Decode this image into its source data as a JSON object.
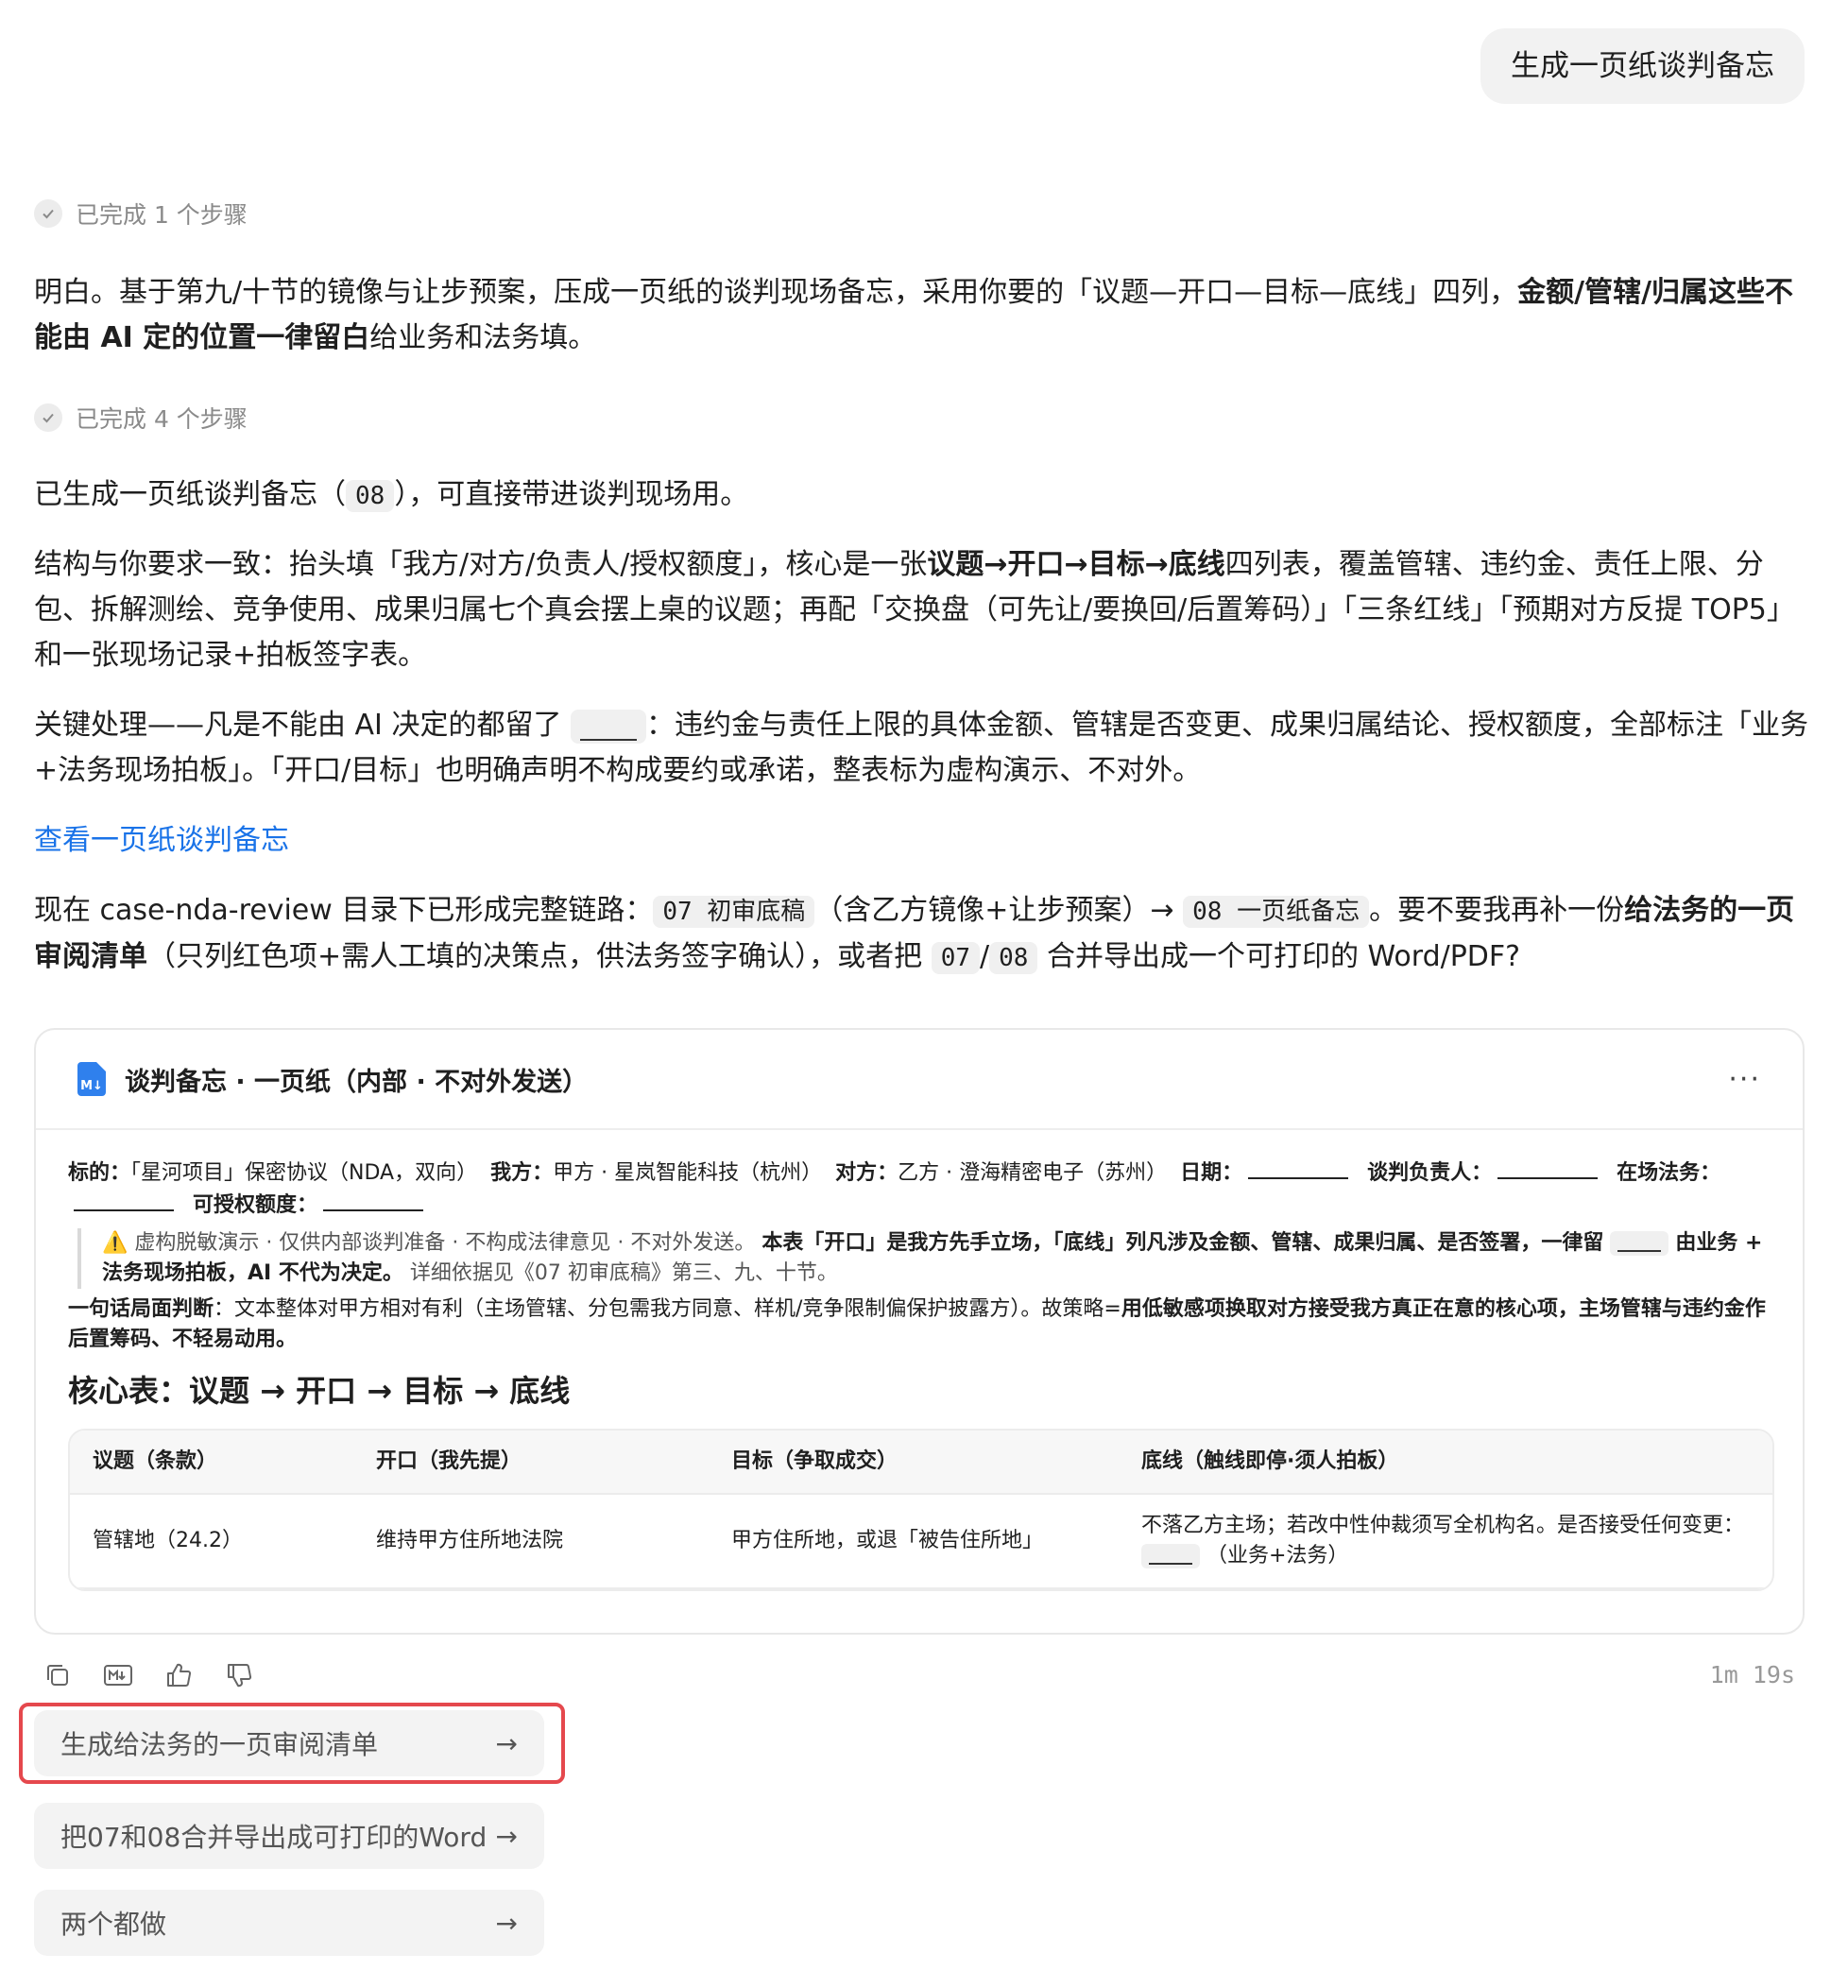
{
  "user_message": "生成一页纸谈判备忘",
  "steps1": "已完成 1 个步骤",
  "steps2": "已完成 4 个步骤",
  "para1": {
    "a": "明白。基于第九/十节的镜像与让步预案，压成一页纸的谈判现场备忘，采用你要的「议题—开口—目标—底线」四列，",
    "b": "金额/管辖/归属这些不能由 AI 定的位置一律留白",
    "c": "给业务和法务填。"
  },
  "para2": {
    "a": "已生成一页纸谈判备忘（",
    "code": "08",
    "b": "），可直接带进谈判现场用。"
  },
  "para3": {
    "a": "结构与你要求一致：抬头填「我方/对方/负责人/授权额度」，核心是一张",
    "b": "议题→开口→目标→底线",
    "c": "四列表，覆盖管辖、违约金、责任上限、分包、拆解测绘、竞争使用、成果归属七个真会摆上桌的议题；再配「交换盘（可先让/要换回/后置筹码）」「三条红线」「预期对方反提 TOP5」和一张现场记录+拍板签字表。"
  },
  "para4": {
    "a": "关键处理——凡是不能由 AI 决定的都留了",
    "b": "：违约金与责任上限的具体金额、管辖是否变更、成果归属结论、授权额度，全部标注「业务+法务现场拍板」。「开口/目标」也明确声明不构成要约或承诺，整表标为虚构演示、不对外。"
  },
  "link": "查看一页纸谈判备忘",
  "para5": {
    "a": "现在 case-nda-review 目录下已形成完整链路：",
    "code1": "07 初审底稿",
    "b": "（含乙方镜像+让步预案）→",
    "code2": "08 一页纸备忘",
    "c": "。要不要我再补一份",
    "d": "给法务的一页审阅清单",
    "e": "（只列红色项+需人工填的决策点，供法务签字确认），或者把",
    "code3": "07",
    "slash": "/",
    "code4": "08",
    "f": "合并导出成一个可打印的 Word/PDF?"
  },
  "card": {
    "title": "谈判备忘 · 一页纸（内部 · 不对外发送）",
    "more": "···",
    "md_badge": "M↓",
    "header_line": {
      "k1": "标的：",
      "v1": "「星河项目」保密协议（NDA，双向）",
      "k2": "我方：",
      "v2": "甲方 · 星岚智能科技（杭州）",
      "k3": "对方：",
      "v3": "乙方 · 澄海精密电子（苏州）",
      "k4": "日期：",
      "k5": "谈判负责人：",
      "k6": "在场法务：",
      "k7": "可授权额度："
    },
    "warning": {
      "icon": "⚠️",
      "a": "虚构脱敏演示 · 仅供内部谈判准备 · 不构成法律意见 · 不对外发送。",
      "b": "本表「开口」是我方先手立场，「底线」列凡涉及金额、管辖、成果归属、是否签署，一律留",
      "c": "由业务 + 法务现场拍板，AI 不代为决定。",
      "d": "详细依据见《07 初审底稿》第三、九、十节。"
    },
    "summary": {
      "k": "一句话局面判断",
      "a": "：文本整体对甲方相对有利（主场管辖、分包需我方同意、样机/竞争限制偏保护披露方）。故策略=",
      "b": "用低敏感项换取对方接受我方真正在意的核心项，主场管辖与违约金作后置筹码、不轻易动用。"
    },
    "heading": "核心表：议题 → 开口 → 目标 → 底线",
    "table": {
      "headers": [
        "议题（条款）",
        "开口（我先提）",
        "目标（争取成交）",
        "底线（触线即停·须人拍板）"
      ],
      "rows": [
        {
          "c1": "管辖地（24.2）",
          "c2": "维持甲方住所地法院",
          "c3": "甲方住所地，或退「被告住所地」",
          "c4a": "不落乙方主场；若改中性仲裁须写全机构名。是否接受任何变更：",
          "c4b": "（业务+法务）"
        }
      ]
    }
  },
  "timer": "1m 19s",
  "suggestions": [
    "生成给法务的一页审阅清单",
    "把07和08合并导出成可打印的Word",
    "两个都做"
  ],
  "suggestion_arrow": "→"
}
